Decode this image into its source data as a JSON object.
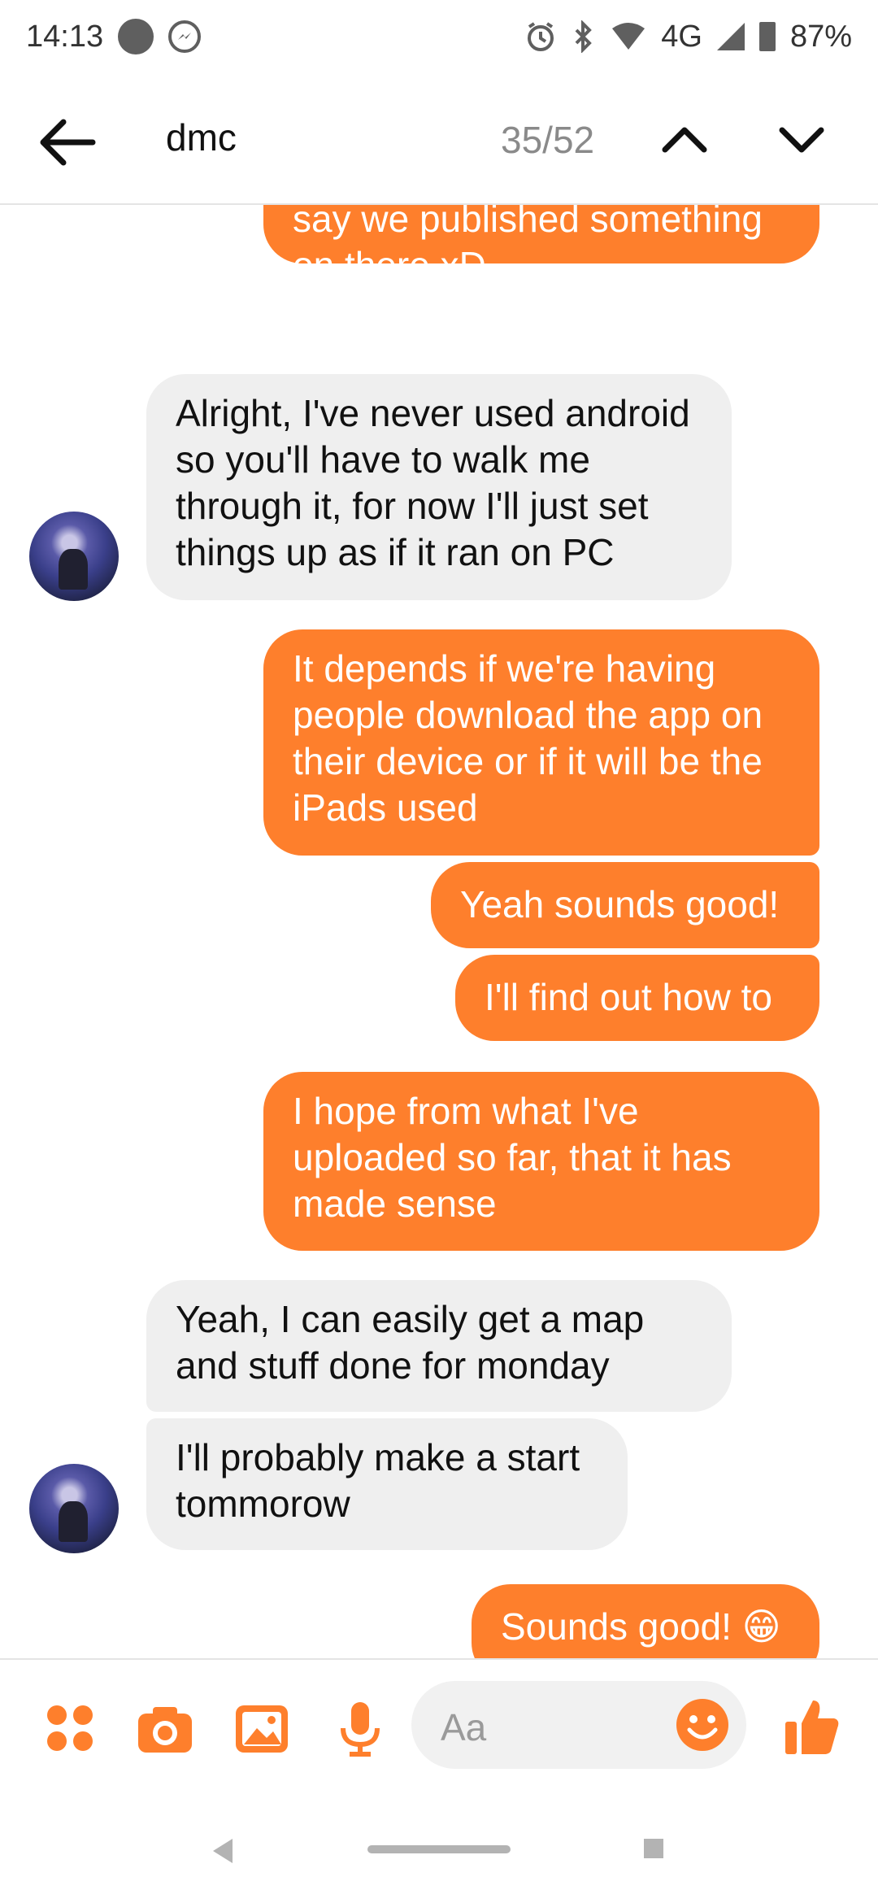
{
  "status_bar": {
    "time": "14:13",
    "network": "4G",
    "battery": "87%"
  },
  "header": {
    "search_term": "dmc",
    "match_count": "35/52"
  },
  "messages": [
    {
      "side": "out",
      "text": "And then on our CVs we can\nsay we published something\non there xD"
    },
    {
      "side": "in",
      "text": "Alright, I've never used android\nso you'll have to walk me\nthrough it, for now I'll just set\nthings up as if it ran on PC"
    },
    {
      "side": "out",
      "text": "It depends if we're having\npeople download the app on\ntheir device or if it will be the\niPads used"
    },
    {
      "side": "out",
      "text": "Yeah sounds good!"
    },
    {
      "side": "out",
      "text": "I'll find out how to"
    },
    {
      "side": "out",
      "text": "I hope from what I've\nuploaded so far, that it has\nmade sense"
    },
    {
      "side": "in",
      "text": "Yeah, I can easily get a map\nand stuff done for monday"
    },
    {
      "side": "in",
      "text": "I'll probably make a start\ntommorow"
    },
    {
      "side": "out",
      "text": "Sounds good! 😁"
    }
  ],
  "composer": {
    "placeholder": "Aa",
    "icons": [
      "apps-icon",
      "camera-icon",
      "gallery-icon",
      "mic-icon",
      "emoji-icon",
      "thumbs-up-icon"
    ]
  },
  "colors": {
    "accent": "#fe7f2c",
    "incoming_bubble": "#efefef"
  }
}
